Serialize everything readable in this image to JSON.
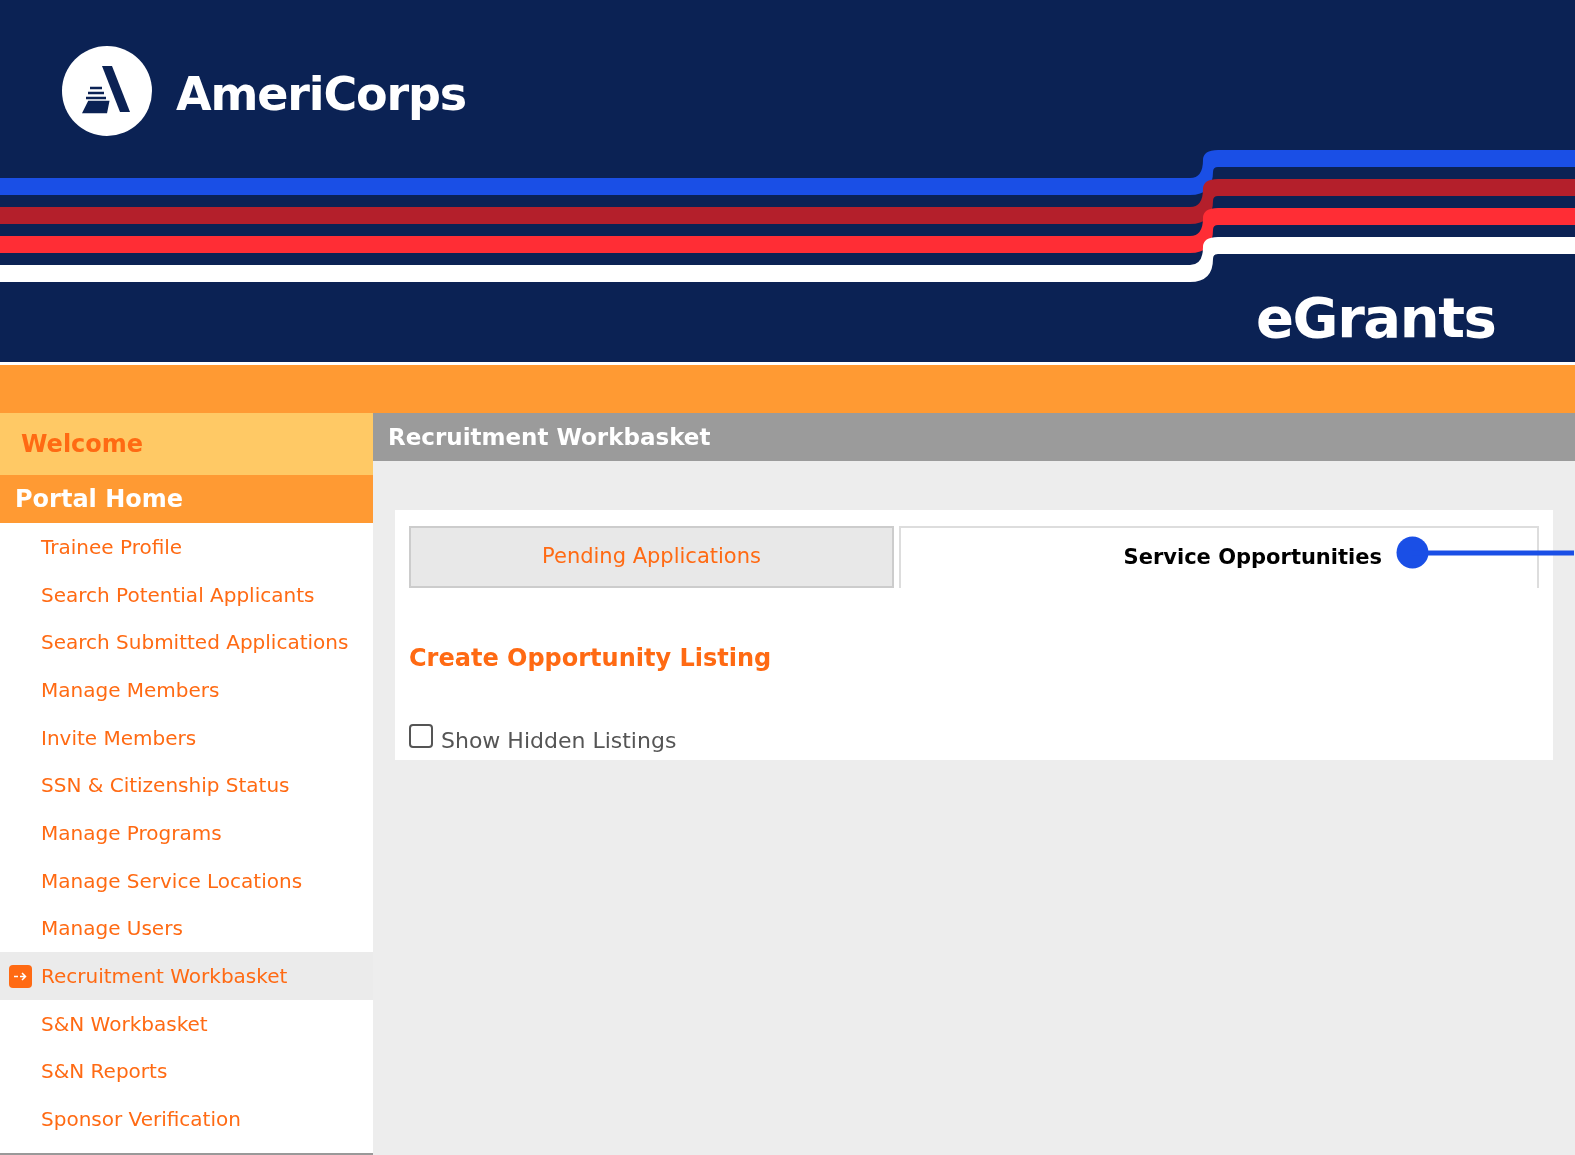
{
  "header": {
    "brand": "AmeriCorps",
    "product": "eGrants"
  },
  "sidebar": {
    "welcome": "Welcome",
    "section": "Portal Home",
    "items": [
      {
        "label": "Trainee Profile",
        "selected": false
      },
      {
        "label": "Search Potential Applicants",
        "selected": false
      },
      {
        "label": "Search Submitted Applications",
        "selected": false
      },
      {
        "label": "Manage Members",
        "selected": false
      },
      {
        "label": "Invite Members",
        "selected": false
      },
      {
        "label": "SSN & Citizenship Status",
        "selected": false
      },
      {
        "label": "Manage Programs",
        "selected": false
      },
      {
        "label": "Manage Service Locations",
        "selected": false
      },
      {
        "label": "Manage Users",
        "selected": false
      },
      {
        "label": "Recruitment Workbasket",
        "selected": true
      },
      {
        "label": "S&N Workbasket",
        "selected": false
      },
      {
        "label": "S&N Reports",
        "selected": false
      },
      {
        "label": "Sponsor Verification",
        "selected": false
      }
    ]
  },
  "page_title": "Recruitment Workbasket",
  "tabs": [
    {
      "label": "Pending Applications",
      "selected": false
    },
    {
      "label": "Service Opportunities",
      "selected": true
    }
  ],
  "create_link": "Create Opportunity Listing",
  "show_hidden": {
    "label": "Show Hidden Listings",
    "checked": false
  }
}
